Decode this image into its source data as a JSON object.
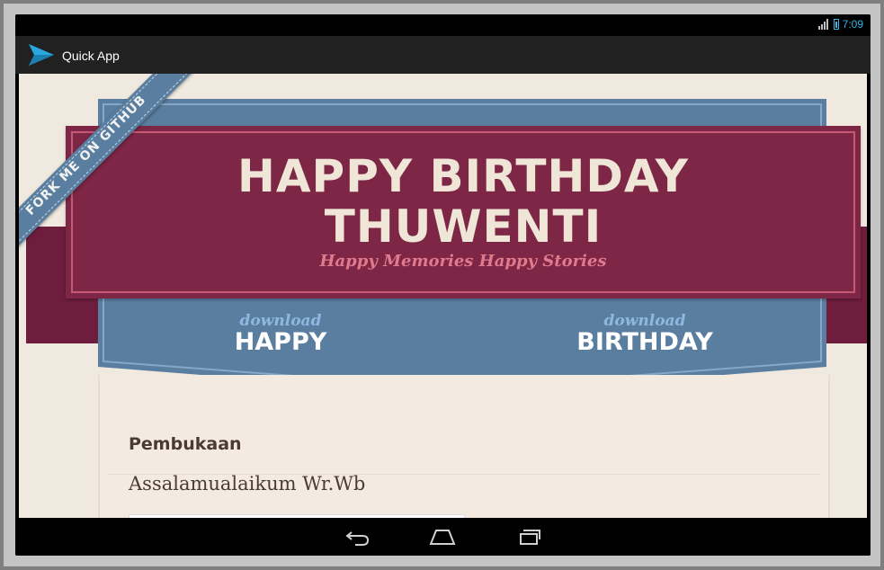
{
  "status": {
    "time": "7:09",
    "network": "3G"
  },
  "actionbar": {
    "app_title": "Quick App"
  },
  "banner": {
    "title_line1": "HAPPY BIRTHDAY",
    "title_line2": "THUWENTI",
    "subtitle": "Happy Memories Happy Stories"
  },
  "downloads": [
    {
      "small": "download",
      "big": "HAPPY"
    },
    {
      "small": "download",
      "big": "BIRTHDAY"
    }
  ],
  "fork_ribbon": {
    "label": "FORK ME ON GITHUB"
  },
  "content": {
    "section_title": "Pembukaan",
    "section_text": "Assalamualaikum Wr.Wb"
  },
  "navbar": {
    "icons": [
      "back-icon",
      "home-icon",
      "recent-apps-icon"
    ]
  },
  "colors": {
    "banner_red": "#7e2645",
    "panel_blue": "#5a7ea0",
    "page_bg": "#efe9df",
    "status_accent": "#33b5e5"
  }
}
